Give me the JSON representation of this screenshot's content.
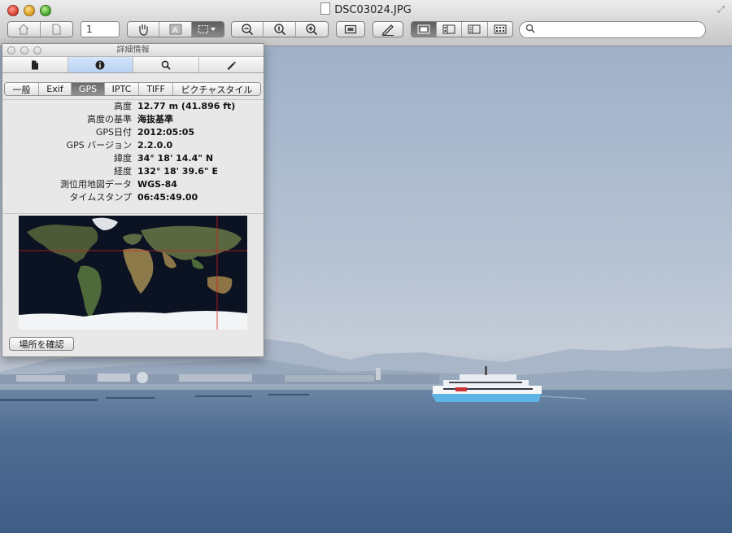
{
  "window": {
    "title": "DSC03024.JPG"
  },
  "toolbar": {
    "page_number": "1",
    "search_placeholder": ""
  },
  "inspector": {
    "title": "詳細情報",
    "top_tabs": [
      "file-icon",
      "info-icon",
      "magnifier-icon",
      "pencil-icon"
    ],
    "sub_tabs": [
      "一般",
      "Exif",
      "GPS",
      "IPTC",
      "TIFF",
      "ピクチャスタイル"
    ],
    "active_sub_tab": "GPS",
    "gps_rows": [
      {
        "key": "高度",
        "value": "12.77 m (41.896 ft)"
      },
      {
        "key": "高度の基準",
        "value": "海抜基準"
      },
      {
        "key": "GPS日付",
        "value": "2012:05:05"
      },
      {
        "key": "GPS バージョン",
        "value": "2.2.0.0"
      },
      {
        "key": "緯度",
        "value": "34° 18' 14.4\" N"
      },
      {
        "key": "経度",
        "value": "132° 18' 39.6\" E"
      },
      {
        "key": "測位用地図データ",
        "value": "WGS-84"
      },
      {
        "key": "タイムスタンプ",
        "value": "06:45:49.00"
      }
    ],
    "locate_button": "場所を確認",
    "map": {
      "latitude": 34.304,
      "longitude": 132.311
    }
  },
  "colors": {
    "active_tab": "#7a7a7a",
    "map_crosshair": "#d42020",
    "ferry_hull": "#5fb4e6"
  }
}
